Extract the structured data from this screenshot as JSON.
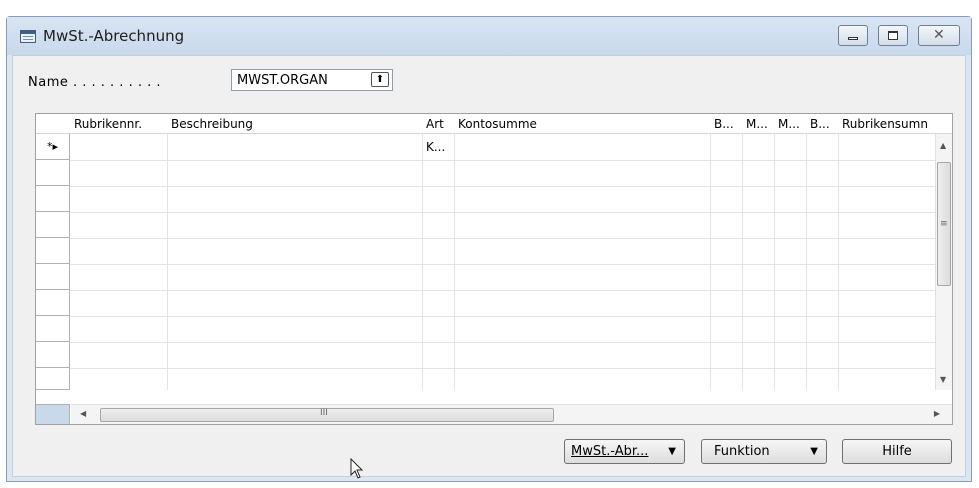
{
  "window": {
    "title": "MwSt.-Abrechnung",
    "icon": "form-icon",
    "controls": [
      "minimize-icon",
      "maximize-icon",
      "close-icon"
    ]
  },
  "header_field": {
    "label": "Name . . . . . . . . . .",
    "value": "MWST.ORGAN",
    "lookup_icon": "lookup-arrow-up-icon"
  },
  "grid": {
    "columns": [
      "Rubrikennr.",
      "Beschreibung",
      "Art",
      "Kontosumme",
      "B...",
      "M...",
      "M...",
      "B...",
      "Rubrikensumn"
    ],
    "new_row_marker": "*▸",
    "rows": [
      [
        "",
        "",
        "K...",
        "",
        "",
        "",
        "",
        "",
        ""
      ]
    ],
    "empty_rows": 9,
    "vscroll_icons": [
      "scroll-up-icon",
      "scroll-grip-icon",
      "scroll-down-icon"
    ],
    "hscroll_icons": [
      "scroll-left-icon",
      "scroll-grip-icon",
      "scroll-right-icon"
    ],
    "hscroll_grip": "III",
    "vscroll_grip": "≡"
  },
  "buttons": {
    "mwst_abr": "MwSt.-Abr...",
    "funktion": "Funktion",
    "hilfe": "Hilfe"
  },
  "colors": {
    "title_bar": "#d7e4f3",
    "content_bg": "#f0f0f0",
    "grid_bg": "#ffffff"
  }
}
